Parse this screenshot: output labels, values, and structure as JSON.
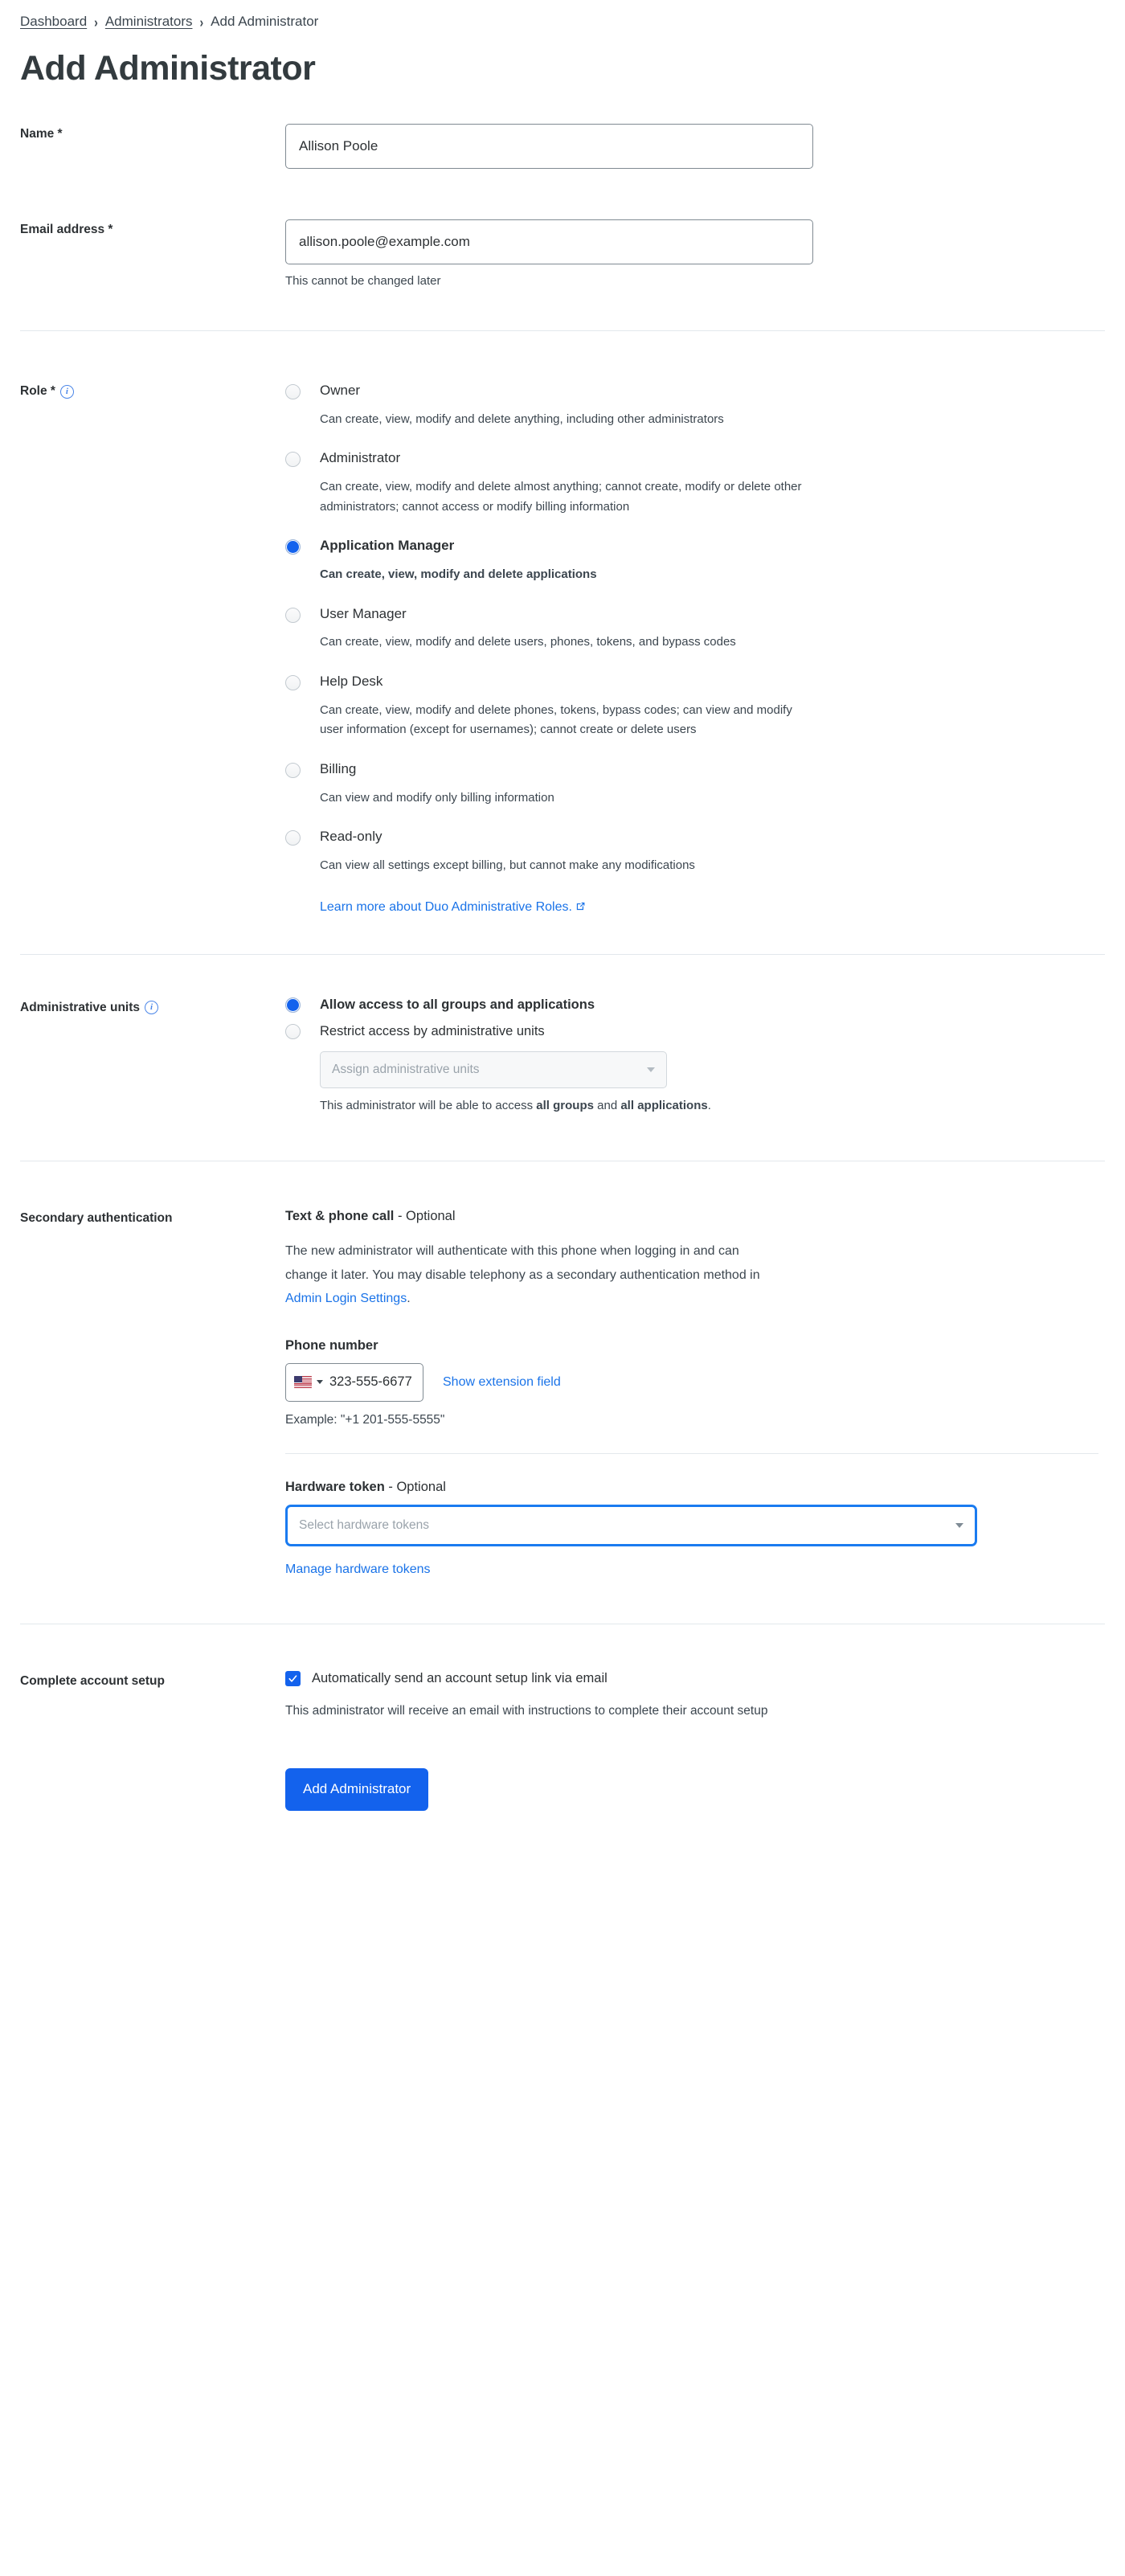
{
  "breadcrumb": {
    "items": [
      {
        "label": "Dashboard",
        "link": true
      },
      {
        "label": "Administrators",
        "link": true
      },
      {
        "label": "Add Administrator",
        "link": false
      }
    ],
    "separator": "›"
  },
  "page": {
    "title": "Add Administrator"
  },
  "name_field": {
    "label": "Name *",
    "value": "Allison Poole"
  },
  "email_field": {
    "label": "Email address *",
    "value": "allison.poole@example.com",
    "helper": "This cannot be changed later"
  },
  "role": {
    "label": "Role *",
    "info_icon": "info-icon",
    "options": [
      {
        "title": "Owner",
        "description": "Can create, view, modify and delete anything, including other administrators",
        "selected": false
      },
      {
        "title": "Administrator",
        "description": "Can create, view, modify and delete almost anything; cannot create, modify or delete other administrators; cannot access or modify billing information",
        "selected": false
      },
      {
        "title": "Application Manager",
        "description": "Can create, view, modify and delete applications",
        "selected": true
      },
      {
        "title": "User Manager",
        "description": "Can create, view, modify and delete users, phones, tokens, and bypass codes",
        "selected": false
      },
      {
        "title": "Help Desk",
        "description": "Can create, view, modify and delete phones, tokens, bypass codes; can view and modify user information (except for usernames); cannot create or delete users",
        "selected": false
      },
      {
        "title": "Billing",
        "description": "Can view and modify only billing information",
        "selected": false
      },
      {
        "title": "Read-only",
        "description": "Can view all settings except billing, but cannot make any modifications",
        "selected": false
      }
    ],
    "learn_more_link": "Learn more about Duo Administrative Roles."
  },
  "admin_units": {
    "label": "Administrative units",
    "info_icon": "info-icon",
    "option_all": "Allow access to all groups and applications",
    "option_restrict": "Restrict access by administrative units",
    "select_placeholder": "Assign administrative units",
    "note_prefix": "This administrator will be able to access ",
    "note_bold_1": "all groups",
    "note_middle": " and ",
    "note_bold_2": "all applications",
    "note_suffix": "."
  },
  "secondary_auth": {
    "label": "Secondary authentication",
    "method_title": "Text & phone call",
    "method_optional": " - Optional",
    "description_part1": "The new administrator will authenticate with this phone when logging in and can change it later. You may disable telephony as a secondary authentication method in ",
    "description_link": "Admin Login Settings",
    "description_part2": ".",
    "phone_label": "Phone number",
    "phone_value": "323-555-6677",
    "phone_country": "US",
    "show_extension_link": "Show extension field",
    "phone_example": "Example: \"+1 201-555-5555\"",
    "hardware_token_label": "Hardware token",
    "hardware_token_optional": " - Optional",
    "hardware_token_placeholder": "Select hardware tokens",
    "manage_tokens_link": "Manage hardware tokens"
  },
  "account_setup": {
    "label": "Complete account setup",
    "checkbox_label": "Automatically send an account setup link via email",
    "checkbox_checked": true,
    "description": "This administrator will receive an email with instructions to complete their account setup"
  },
  "submit": {
    "label": "Add Administrator"
  },
  "colors": {
    "accent": "#1362ed",
    "link": "#1a73e8",
    "text": "#2d3134",
    "muted": "#3c464f",
    "divider": "#e3e8ec"
  }
}
